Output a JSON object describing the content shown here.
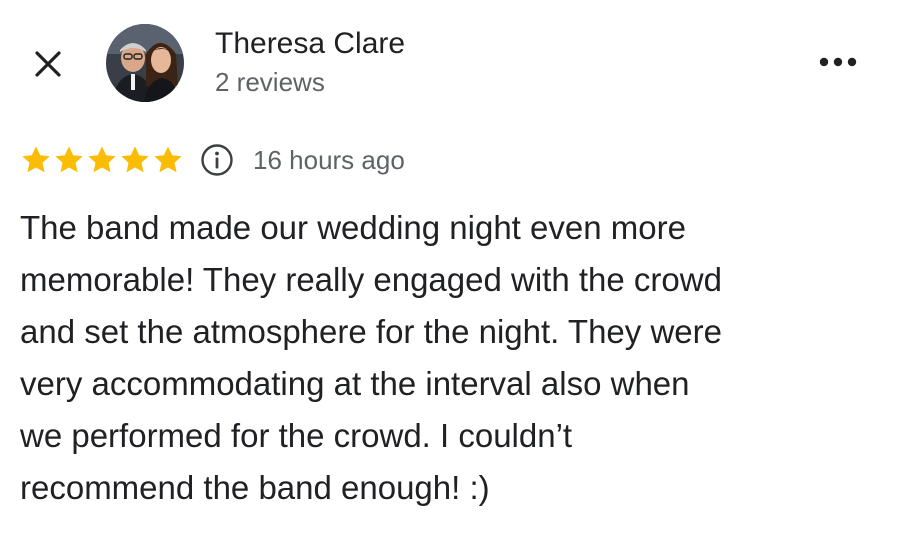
{
  "header": {
    "close_icon": "close-icon",
    "avatar_icon": "profile-photo",
    "reviewer_name": "Theresa Clare",
    "review_count": "2 reviews",
    "more_icon": "more-horizontal-icon"
  },
  "rating": {
    "stars": 5,
    "max_stars": 5,
    "star_color": "#fbbc04",
    "info_icon": "info-icon",
    "timestamp": "16 hours ago"
  },
  "review": {
    "lines": [
      "The band made our wedding night even more",
      "memorable! They really engaged with the crowd",
      "and set the atmosphere for the night. They were",
      "very accommodating at the interval also when",
      "we performed for the crowd. I couldn’t",
      "recommend the band enough! :)"
    ]
  }
}
